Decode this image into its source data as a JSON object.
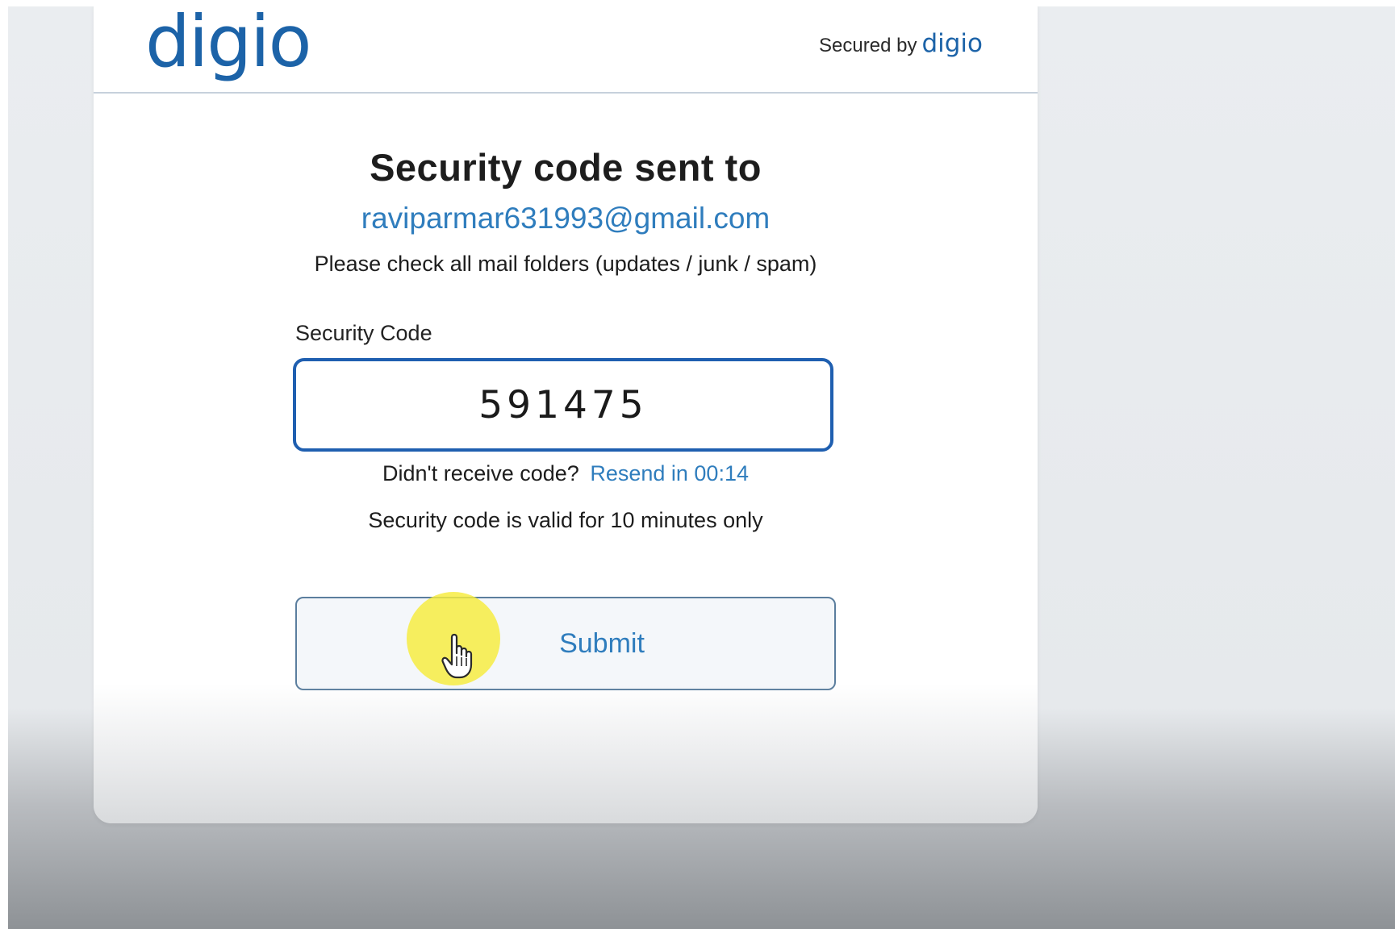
{
  "header": {
    "logo_text": "digio",
    "secured_label": "Secured by",
    "secured_brand": "digio"
  },
  "main": {
    "title": "Security code sent to",
    "email": "raviparmar631993@gmail.com",
    "hint": "Please check all mail folders (updates / junk / spam)",
    "field_label": "Security Code",
    "code_value": "591475",
    "resend_prompt": "Didn't receive code?",
    "resend_link": "Resend in 00:14",
    "validity_note": "Security code is valid for 10 minutes only",
    "submit_label": "Submit"
  },
  "colors": {
    "brand": "#1c63a8",
    "link": "#2f7dbd",
    "input_border": "#1f5fb0",
    "cursor_highlight": "#f7ec3c"
  },
  "icons": {
    "cursor": "hand-pointer-icon"
  }
}
